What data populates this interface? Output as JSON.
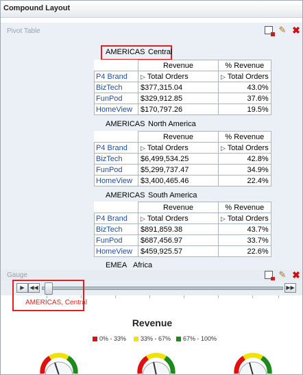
{
  "title": "Compound Layout",
  "pivot": {
    "section_title": "Pivot Table",
    "headers": {
      "revenue": "Revenue",
      "pct_revenue": "% Revenue",
      "total_orders": "Total Orders",
      "dimension": "P4 Brand"
    },
    "tables": [
      {
        "region": "AMERICAS",
        "subregion": "Central",
        "rows": [
          {
            "brand": "BizTech",
            "revenue": "$377,315.04",
            "pct": "43.0%"
          },
          {
            "brand": "FunPod",
            "revenue": "$329,912.85",
            "pct": "37.6%"
          },
          {
            "brand": "HomeView",
            "revenue": "$170,797.26",
            "pct": "19.5%"
          }
        ]
      },
      {
        "region": "AMERICAS",
        "subregion": "North America",
        "rows": [
          {
            "brand": "BizTech",
            "revenue": "$6,499,534.25",
            "pct": "42.8%"
          },
          {
            "brand": "FunPod",
            "revenue": "$5,299,737.47",
            "pct": "34.9%"
          },
          {
            "brand": "HomeView",
            "revenue": "$3,400,465.46",
            "pct": "22.4%"
          }
        ]
      },
      {
        "region": "AMERICAS",
        "subregion": "South America",
        "rows": [
          {
            "brand": "BizTech",
            "revenue": "$891,859.38",
            "pct": "43.7%"
          },
          {
            "brand": "FunPod",
            "revenue": "$687,456.97",
            "pct": "33.7%"
          },
          {
            "brand": "HomeView",
            "revenue": "$459,925.57",
            "pct": "22.6%"
          }
        ]
      }
    ],
    "next_label": {
      "region": "EMEA",
      "subregion": "Africa"
    }
  },
  "gauge": {
    "section_title": "Gauge",
    "slider_value": "AMERICAS, Central",
    "chart_title": "Revenue",
    "legend": [
      {
        "label": "0% - 33%",
        "color": "#e01010"
      },
      {
        "label": "33% - 67%",
        "color": "#f2e200"
      },
      {
        "label": "67% - 100%",
        "color": "#1e8a1e"
      }
    ]
  },
  "icons": {
    "export": "export-icon",
    "edit": "pencil-icon",
    "close": "close-icon",
    "play": "play-icon",
    "step_back": "step-back-icon",
    "step_forward": "step-forward-icon"
  }
}
